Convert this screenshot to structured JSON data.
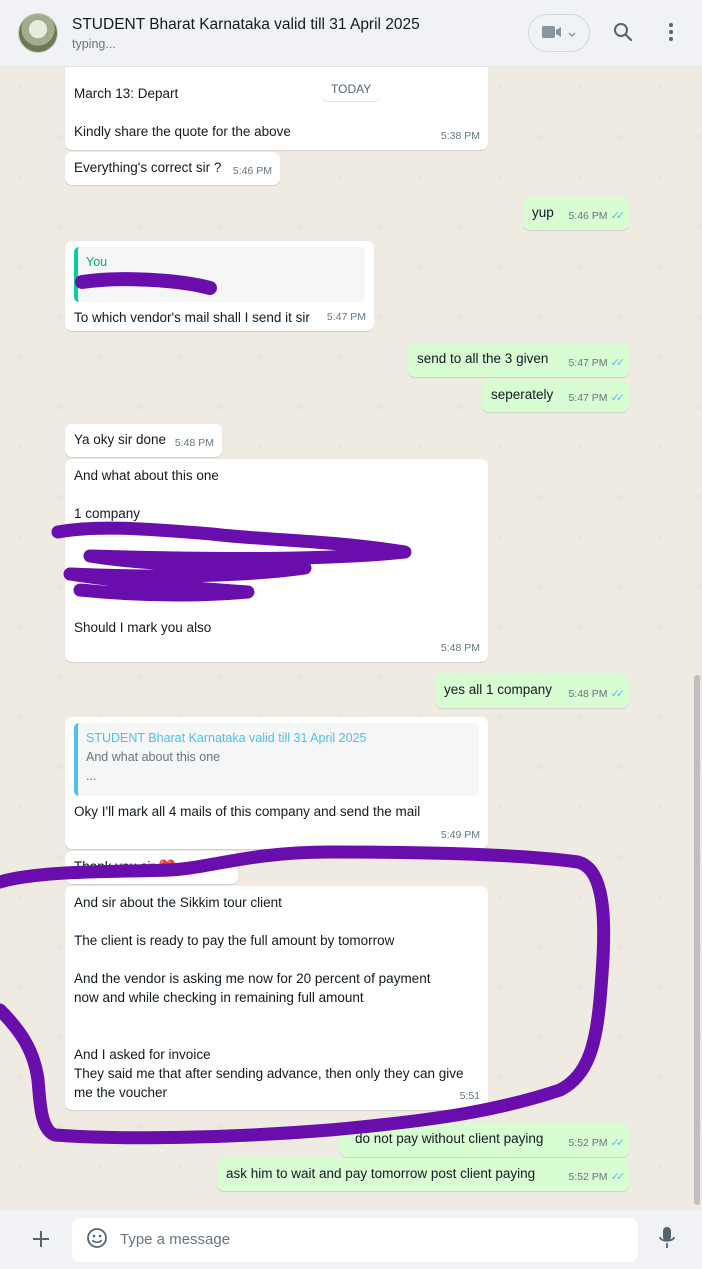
{
  "header": {
    "contact_name": "STUDENT Bharat Karnataka valid till 31 April 2025",
    "status": "typing..."
  },
  "date_badge": "TODAY",
  "messages": {
    "m1": {
      "lines": [
        "March 13: Depart",
        "",
        "Kindly share the quote for the above"
      ],
      "time": "5:38 PM"
    },
    "m2": {
      "text": "Everything's correct sir ?",
      "time": "5:46 PM"
    },
    "m3": {
      "text": "yup",
      "time": "5:46 PM"
    },
    "m4": {
      "quote_author": "You",
      "text": "To which vendor's mail shall I send it sir",
      "time": "5:47 PM"
    },
    "m5": {
      "text": "send to all the 3 given",
      "time": "5:47 PM"
    },
    "m6": {
      "text": "seperately",
      "time": "5:47 PM"
    },
    "m7": {
      "text": "Ya oky sir done",
      "time": "5:48 PM"
    },
    "m8": {
      "line1": "And what about this one",
      "line2": "1 company",
      "line3": "Should I mark you also",
      "time": "5:48 PM"
    },
    "m9": {
      "text": "yes all 1 company",
      "time": "5:48 PM"
    },
    "m10": {
      "quote_author": "STUDENT Bharat Karnataka valid till 31 April 2025",
      "quote_line1": "And what about this one",
      "quote_line2": "...",
      "text": "Oky I'll mark all 4 mails of this company and send the mail",
      "time": "5:49 PM"
    },
    "m11": {
      "text": "Thank you sir ❤️"
    },
    "m12": {
      "l1": "And sir about the Sikkim tour client",
      "l2": "The client is ready to pay the full amount by tomorrow",
      "l3": "And the vendor is asking me now for 20 percent of payment",
      "l4": "now and while checking in remaining full amount",
      "l5": "And I asked for invoice",
      "l6": "They said me that after sending advance, then only they can give",
      "l7": "me the voucher",
      "time": "5:51"
    },
    "m13": {
      "text": "do not pay without client paying",
      "time": "5:52 PM"
    },
    "m14": {
      "text": "ask him to wait and pay tomorrow post client paying",
      "time": "5:52 PM"
    }
  },
  "composer": {
    "placeholder": "Type a message"
  },
  "colors": {
    "outgoing": "#d9fdd3",
    "incoming": "#ffffff",
    "annotation": "#6a0dad",
    "read_ticks": "#53bdeb"
  },
  "icons": [
    "video-call-icon",
    "search-icon",
    "menu-icon",
    "plus-icon",
    "emoji-icon",
    "mic-icon"
  ]
}
